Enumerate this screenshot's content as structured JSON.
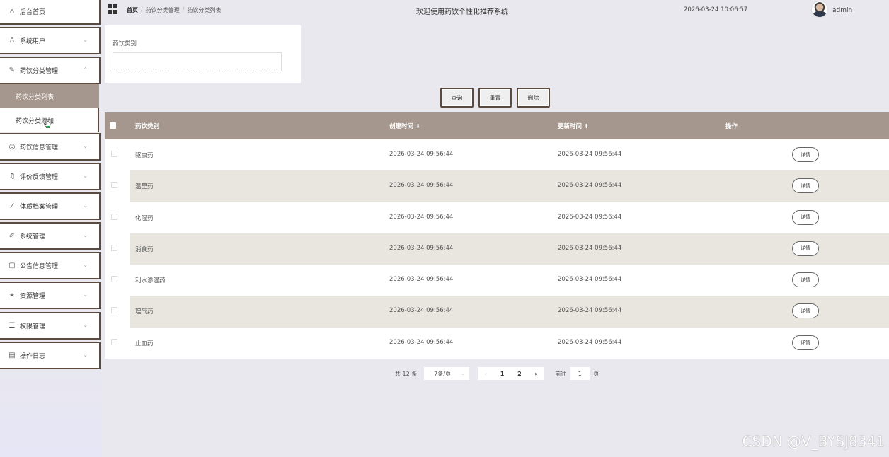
{
  "sidebar": {
    "home": "后台首页",
    "items": [
      {
        "label": "系统用户",
        "icon": "user-icon",
        "glyph": "♙"
      },
      {
        "label": "药饮分类管理",
        "icon": "edit-icon",
        "glyph": "✎"
      },
      {
        "label": "药饮信息管理",
        "icon": "globe-icon",
        "glyph": "◎"
      },
      {
        "label": "评价反馈管理",
        "icon": "bell-icon",
        "glyph": "♫"
      },
      {
        "label": "体质档案管理",
        "icon": "chart-icon",
        "glyph": "⁄"
      },
      {
        "label": "系统管理",
        "icon": "pen-icon",
        "glyph": "✐"
      },
      {
        "label": "公告信息管理",
        "icon": "document-icon",
        "glyph": "▢"
      },
      {
        "label": "资源管理",
        "icon": "link-icon",
        "glyph": "⚭"
      },
      {
        "label": "权限管理",
        "icon": "list-icon",
        "glyph": "☰"
      },
      {
        "label": "操作日志",
        "icon": "log-icon",
        "glyph": "▤"
      }
    ],
    "sub_items": {
      "list": "药饮分类列表",
      "add": "药饮分类添加"
    }
  },
  "header": {
    "breadcrumbs": [
      "首页",
      "药饮分类管理",
      "药饮分类列表"
    ],
    "title": "欢迎使用药饮个性化推荐系统",
    "datetime": "2026-03-24 10:06:57",
    "username": "admin"
  },
  "search": {
    "label": "药饮类别",
    "value": ""
  },
  "buttons": {
    "query": "查询",
    "reset": "重置",
    "delete": "删除"
  },
  "table": {
    "headers": {
      "category": "药饮类别",
      "created": "创建时间 ⬍",
      "updated": "更新时间 ⬍",
      "action": "操作"
    },
    "rows": [
      {
        "category": "驱虫药",
        "created": "2026-03-24 09:56:44",
        "updated": "2026-03-24 09:56:44",
        "action": "详情"
      },
      {
        "category": "温里药",
        "created": "2026-03-24 09:56:44",
        "updated": "2026-03-24 09:56:44",
        "action": "详情"
      },
      {
        "category": "化湿药",
        "created": "2026-03-24 09:56:44",
        "updated": "2026-03-24 09:56:44",
        "action": "详情"
      },
      {
        "category": "消食药",
        "created": "2026-03-24 09:56:44",
        "updated": "2026-03-24 09:56:44",
        "action": "详情"
      },
      {
        "category": "利水渗湿药",
        "created": "2026-03-24 09:56:44",
        "updated": "2026-03-24 09:56:44",
        "action": "详情"
      },
      {
        "category": "理气药",
        "created": "2026-03-24 09:56:44",
        "updated": "2026-03-24 09:56:44",
        "action": "详情"
      },
      {
        "category": "止血药",
        "created": "2026-03-24 09:56:44",
        "updated": "2026-03-24 09:56:44",
        "action": "详情"
      }
    ]
  },
  "pagination": {
    "total": "共 12 条",
    "page_size": "7条/页",
    "prev": "‹",
    "pages": [
      "1",
      "2"
    ],
    "next": "›",
    "goto_label": "前往",
    "goto_value": "1",
    "page_suffix": "页"
  },
  "watermark": "CSDN @V_BYSJ8341",
  "colors": {
    "accent": "#a5978d",
    "border_dark": "#5b4a40",
    "background": "#e9e8ee"
  }
}
